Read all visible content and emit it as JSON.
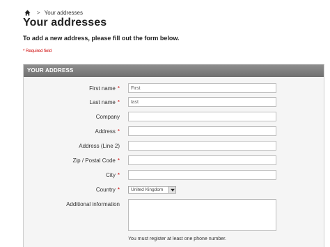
{
  "breadcrumb": {
    "home_icon": "home-icon",
    "separator": ">",
    "current": "Your addresses"
  },
  "page": {
    "title": "Your addresses",
    "intro": "To add a new address, please fill out the form below.",
    "required_note": "* Required field"
  },
  "form": {
    "header": "YOUR ADDRESS",
    "required_marker": "*",
    "fields": {
      "firstname": {
        "label": "First name",
        "value": "First",
        "required": true
      },
      "lastname": {
        "label": "Last name",
        "value": "last",
        "required": true
      },
      "company": {
        "label": "Company",
        "value": "",
        "required": false
      },
      "address": {
        "label": "Address",
        "value": "",
        "required": true
      },
      "address2": {
        "label": "Address (Line 2)",
        "value": "",
        "required": false
      },
      "postcode": {
        "label": "Zip / Postal Code",
        "value": "",
        "required": true
      },
      "city": {
        "label": "City",
        "value": "",
        "required": true
      },
      "country": {
        "label": "Country",
        "value": "United Kingdom",
        "required": true
      },
      "other": {
        "label": "Additional information",
        "value": "",
        "required": false
      }
    },
    "phone_note": "You must register at least one phone number."
  },
  "colors": {
    "required": "#cc0000",
    "header_bg": "#7a7a7a",
    "panel_bg": "#f5f5f5"
  }
}
